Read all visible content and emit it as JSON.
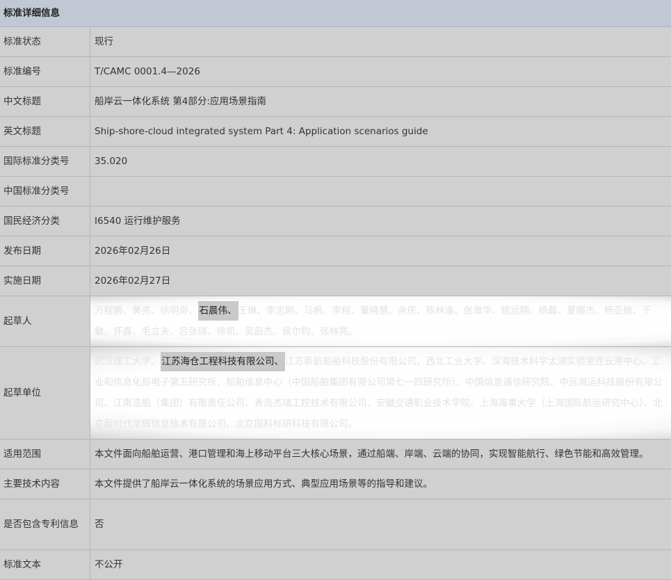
{
  "header": {
    "title": "标准详细信息"
  },
  "rows": [
    {
      "label": "标准状态",
      "value": "现行"
    },
    {
      "label": "标准编号",
      "value": "T/CAMC 0001.4—2026"
    },
    {
      "label": "中文标题",
      "value": "船岸云一体化系统 第4部分:应用场景指南"
    },
    {
      "label": "英文标题",
      "value": "Ship-shore-cloud integrated system Part 4: Application scenarios guide"
    },
    {
      "label": "国际标准分类号",
      "value": "35.020"
    },
    {
      "label": "中国标准分类号",
      "value": ""
    },
    {
      "label": "国民经济分类",
      "value": "I6540 运行维护服务"
    },
    {
      "label": "发布日期",
      "value": "2026年02月26日"
    },
    {
      "label": "实施日期",
      "value": "2026年02月27日"
    }
  ],
  "drafters": {
    "label": "起草人",
    "before": "万程鹏、黄亮、徐明奇、",
    "highlight": "石晨伟、",
    "after": "王琳、李志刚、马帆、李程、董晓慧、余庆、陈林逢、张海华、姚远翔、杨磊、夏娜杰、杨亚楠、于敏、怀鑫、毛立夫、吕张瑞、徐凯、吴辰杰、侯尔钧、张林亮。"
  },
  "units": {
    "label": "起草单位",
    "before": "武汉理工大学、",
    "highlight": "江苏海仓工程科技有限公司、",
    "after": "江苏新航船舶科技股份有限公司、西北工业大学、深海技术科学太湖实验室连云港中心、工业和信息化部电子第五研究所、船舶信息中心（中国船舶集团有限公司第七一四研究所）、中国信息通信研究院、中远海运科技股份有限公司、江南造船（集团）有限责任公司、青岛杰瑞工控技术有限公司、安徽交通职业技术学院、上海海事大学（上海国际航运研究中心）、北京新时代华辉信息技术有限公司、北京国科标研科技有限公司。"
  },
  "rows2": [
    {
      "label": "适用范围",
      "value": "本文件面向船舶运营、港口管理和海上移动平台三大核心场景，通过船端、岸端、云端的协同，实现智能航行、绿色节能和高效管理。"
    },
    {
      "label": "主要技术内容",
      "value": "本文件提供了船岸云一体化系统的场景应用方式、典型应用场景等的指导和建议。"
    },
    {
      "label": "是否包含专利信息",
      "value": "否"
    },
    {
      "label": "标准文本",
      "value": "不公开"
    }
  ]
}
